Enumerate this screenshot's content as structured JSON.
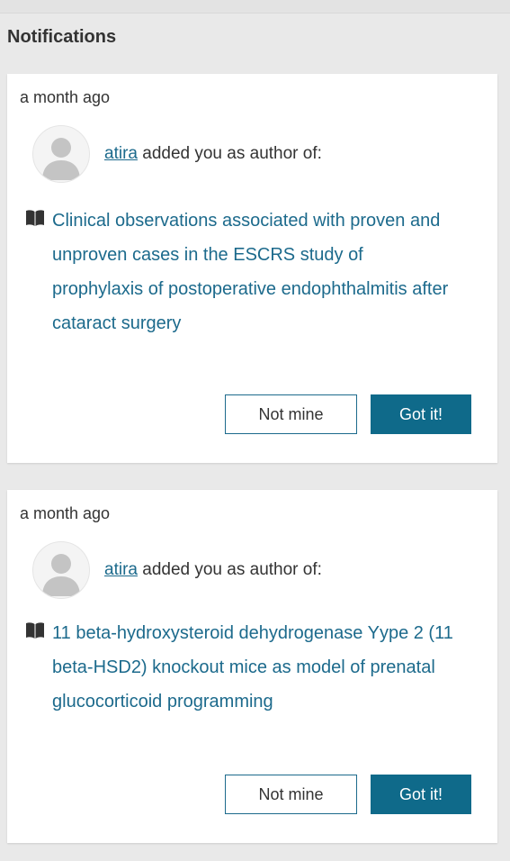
{
  "section": {
    "title": "Notifications"
  },
  "notifications": [
    {
      "timestamp": "a month ago",
      "author": "atira",
      "action_text": "added you as author of:",
      "publication_title": "Clinical observations associated with proven and unproven cases in the ESCRS study of prophylaxis of postoperative endophthalmitis after cataract surgery",
      "not_mine_label": "Not mine",
      "got_it_label": "Got it!"
    },
    {
      "timestamp": "a month ago",
      "author": "atira",
      "action_text": "added you as author of:",
      "publication_title": "11 beta-hydroxysteroid dehydrogenase Yype 2 (11 beta-HSD2) knockout mice as model of prenatal glucocorticoid programming",
      "not_mine_label": "Not mine",
      "got_it_label": "Got it!"
    }
  ],
  "colors": {
    "link": "#1c6a8c",
    "primary_button": "#0f6a8a",
    "page_background": "#e9e9e9"
  },
  "icons": {
    "avatar": "user-silhouette-icon",
    "publication": "open-book-icon"
  }
}
